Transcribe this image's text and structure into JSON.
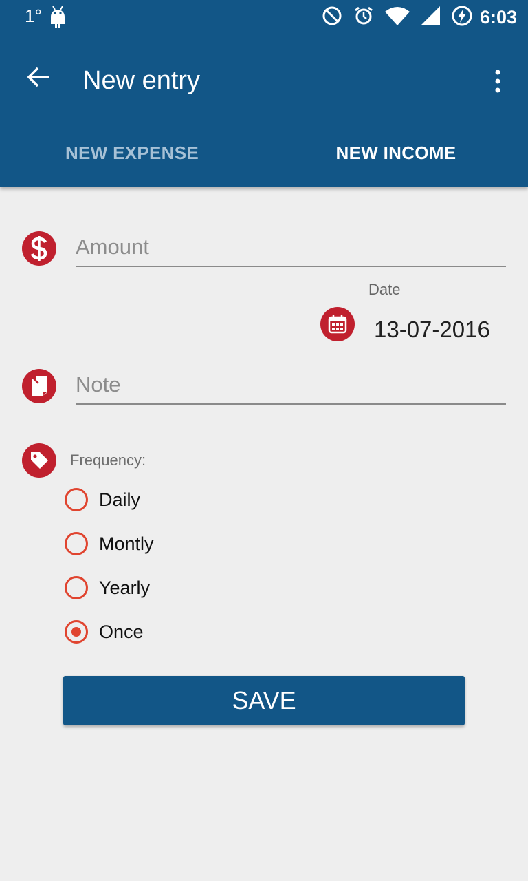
{
  "status_bar": {
    "temperature": "1°",
    "time": "6:03"
  },
  "toolbar": {
    "title": "New entry"
  },
  "tabs": [
    {
      "label": "NEW EXPENSE",
      "selected": false
    },
    {
      "label": "NEW INCOME",
      "selected": true
    }
  ],
  "form": {
    "amount": {
      "placeholder": "Amount",
      "value": ""
    },
    "date": {
      "label": "Date",
      "value": "13-07-2016"
    },
    "note": {
      "placeholder": "Note",
      "value": ""
    },
    "frequency": {
      "label": "Frequency:",
      "options": [
        {
          "label": "Daily",
          "checked": false
        },
        {
          "label": "Montly",
          "checked": false
        },
        {
          "label": "Yearly",
          "checked": false
        },
        {
          "label": "Once",
          "checked": true
        }
      ]
    },
    "save_label": "SAVE"
  },
  "colors": {
    "primary": "#125687",
    "icon_accent": "#c0202e",
    "radio_accent": "#e0442f",
    "background": "#eeeeee"
  }
}
